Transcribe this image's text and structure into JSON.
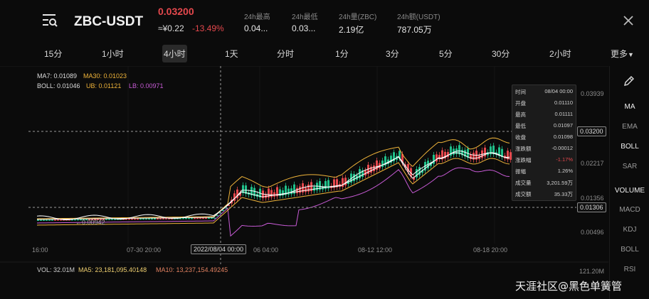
{
  "header": {
    "pair": "ZBC-USDT",
    "price": "0.03200",
    "cny_price": "≈¥0.22",
    "change_pct": "-13.49%",
    "stats": [
      {
        "label": "24h最高",
        "value": "0.04..."
      },
      {
        "label": "24h最低",
        "value": "0.03..."
      },
      {
        "label": "24h量(ZBC)",
        "value": "2.19亿"
      },
      {
        "label": "24h额(USDT)",
        "value": "787.05万"
      }
    ]
  },
  "intervals": [
    "15分",
    "1小时",
    "4小时",
    "1天",
    "分时",
    "1分",
    "3分",
    "5分",
    "30分",
    "2小时"
  ],
  "active_interval": "4小时",
  "more_label": "更多",
  "legend": {
    "ma7": "MA7: 0.01089",
    "ma30": "MA30: 0.01023",
    "boll": "BOLL: 0.01046",
    "ub": "UB: 0.01121",
    "lb": "LB: 0.00971"
  },
  "y_axis": {
    "labels": [
      "0.03939",
      "0.02217",
      "0.01356",
      "0.00496"
    ],
    "crosshair_price": "0.03200",
    "last_price": "0.01306"
  },
  "x_axis": {
    "labels": [
      "16:00",
      "07-30 20:00",
      "06 04:00",
      "08-12 12:00",
      "08-18 20:00"
    ],
    "crosshair_label": "2022/08/04 00:00"
  },
  "min_marker": "0.00942",
  "tooltip": [
    {
      "key": "时间",
      "value": "08/04 00:00"
    },
    {
      "key": "开盘",
      "value": "0.01110"
    },
    {
      "key": "最高",
      "value": "0.01111"
    },
    {
      "key": "最低",
      "value": "0.01097"
    },
    {
      "key": "收盘",
      "value": "0.01098"
    },
    {
      "key": "涨跌额",
      "value": "-0.00012"
    },
    {
      "key": "涨跌幅",
      "value": "-1.17%"
    },
    {
      "key": "振幅",
      "value": "1.26%"
    },
    {
      "key": "成交量",
      "value": "3,201.59万"
    },
    {
      "key": "成交额",
      "value": "35.33万"
    }
  ],
  "volume": {
    "vol": "VOL: 32.01M",
    "ma5": "MA5: 23,181,095.40148",
    "ma10": "MA10: 13,237,154.49245",
    "max_label": "121.20M"
  },
  "indicators": [
    "MA",
    "EMA",
    "BOLL",
    "SAR",
    "VOLUME",
    "MACD",
    "KDJ",
    "BOLL",
    "RSI"
  ],
  "watermark": "天涯社区@黑色单簧管",
  "colors": {
    "up": "#20c08a",
    "down": "#e5484d",
    "ma7": "#ffffff",
    "ma30": "#f0b43a",
    "boll": "#ffffff",
    "ub": "#f0b43a",
    "lb": "#c85bd6"
  },
  "icons": {
    "menu": "menu-search-icon",
    "close": "close-icon",
    "edit": "pencil-icon",
    "more": "caret-down-icon"
  }
}
